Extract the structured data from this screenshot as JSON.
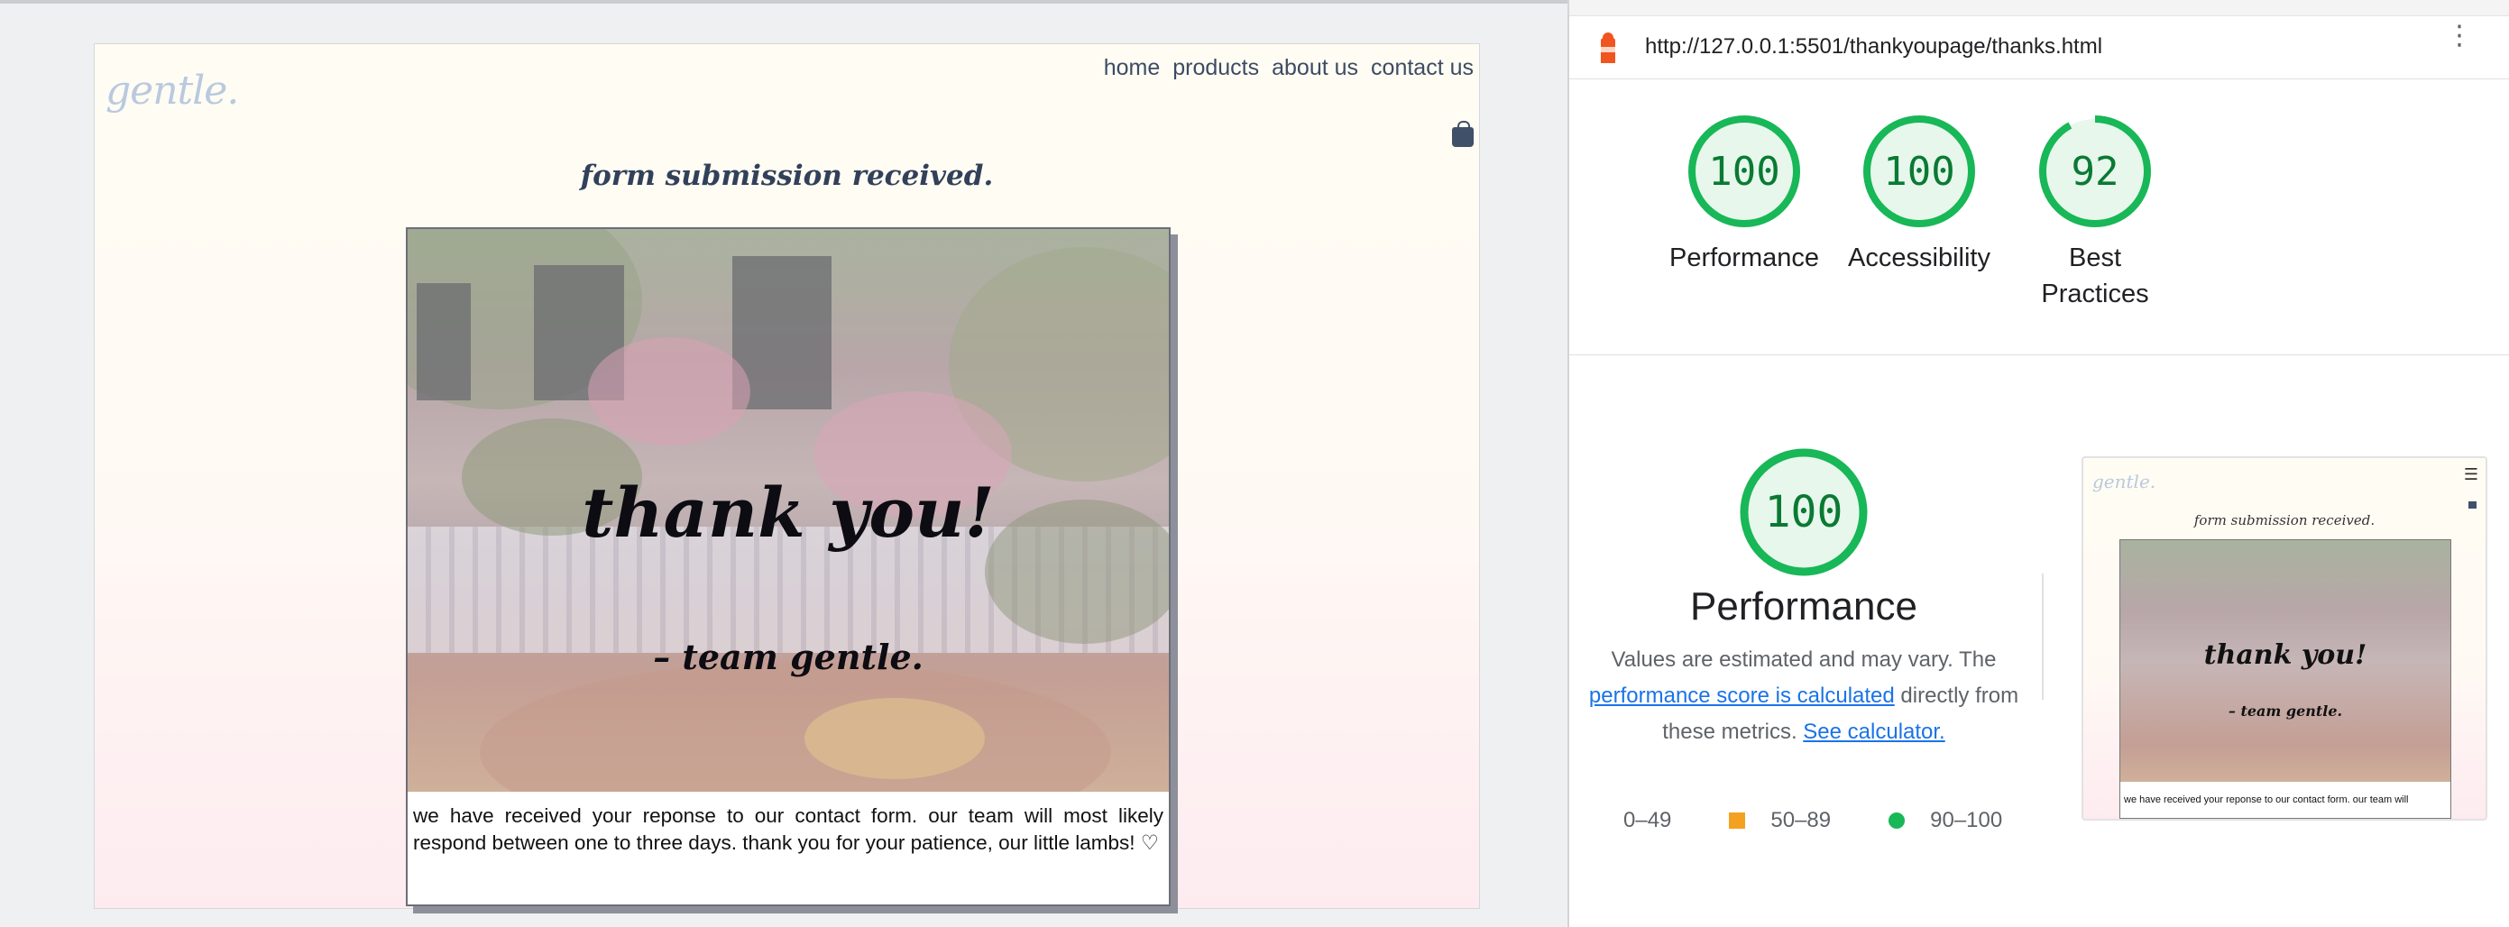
{
  "site": {
    "logo": "gentle.",
    "nav": [
      "home",
      "products",
      "about us",
      "contact us"
    ],
    "cart_icon": "shopping-bag-icon",
    "heading": "form submission received.",
    "card": {
      "title": "thank you!",
      "signature": "– team gentle.",
      "message": "we have received your reponse to our contact form. our team will most likely respond between one to three days. thank you for your patience, our little lambs! ♡"
    }
  },
  "lighthouse": {
    "url": "http://127.0.0.1:5501/thankyoupage/thanks.html",
    "icon": "lighthouse-icon",
    "menu_icon": "more-vert-icon",
    "scores": [
      {
        "label": "Performance",
        "value": "100",
        "score": 100
      },
      {
        "label": "Accessibility",
        "value": "100",
        "score": 100
      },
      {
        "label": "Best Practices",
        "value": "92",
        "score": 92
      }
    ],
    "performance": {
      "score": "100",
      "title": "Performance",
      "text_before": "Values are estimated and may vary. The ",
      "link1": "performance score is calculated",
      "text_middle": " directly from these metrics. ",
      "link2": "See calculator."
    },
    "legend": {
      "fail": "0–49",
      "average": "50–89",
      "pass": "90–100"
    },
    "colors": {
      "pass": "#18b757",
      "average": "#f4a11f",
      "fail": "#e62e2e",
      "pass_text": "#0a7a33",
      "link": "#1a73e8"
    },
    "thumbnail": {
      "logo": "gentle.",
      "heading": "form submission received.",
      "title": "thank you!",
      "signature": "– team gentle.",
      "message": "we have received your reponse to our contact form. our team will"
    }
  }
}
